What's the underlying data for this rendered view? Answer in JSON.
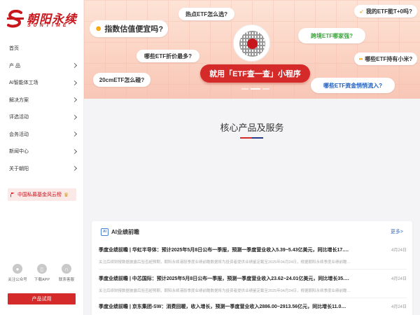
{
  "brand": {
    "cn": "朝阳永续",
    "en": "SUNTIME",
    "color": "#c8161d"
  },
  "nav": [
    {
      "label": "首页",
      "has_arrow": false
    },
    {
      "label": "产 品",
      "has_arrow": true
    },
    {
      "label": "AI智能体工场",
      "has_arrow": true
    },
    {
      "label": "解决方案",
      "has_arrow": true
    },
    {
      "label": "评选活动",
      "has_arrow": true
    },
    {
      "label": "会务活动",
      "has_arrow": true
    },
    {
      "label": "新闻中心",
      "has_arrow": true
    },
    {
      "label": "关于朝阳",
      "has_arrow": true
    }
  ],
  "award": "中国私募基金风云榜",
  "qr_links": [
    {
      "label": "关注公众号",
      "icon": "wechat-icon"
    },
    {
      "label": "下载APP",
      "icon": "phone-icon"
    },
    {
      "label": "联系客服",
      "icon": "headset-icon"
    }
  ],
  "trial_button": "产品试用",
  "banner": {
    "bubbles": {
      "b1": "指数估值便宜吗?",
      "b2": "热点ETF怎么选?",
      "b3": "我的ETF能T+0吗?",
      "b4": "跨境ETF哪家强?",
      "b5": "哪些ETF折价最多?",
      "b6": "哪些ETF持有小米?",
      "b7": "20cmETF怎么碰?",
      "b8": "哪些ETF资金悄悄流入?"
    },
    "promo": "就用「ETF查一查」小程序"
  },
  "section_title": "核心产品及服务",
  "ai_card": {
    "title": "AI业绩前瞻",
    "more": "更多>",
    "items": [
      {
        "title": "季度业绩前瞻 | 华虹半导体：预计2025年5月8日公布一季报，预测一季度营业收入5.39~5.43亿美元，同比增长17.…",
        "date": "4月24日",
        "summary": "关注后续财报数据披露后验否超预期，朝阳永续港股季度业绩前瞻数据将为投资者提供业绩鉴定截至2025年04月24日，根据朝阳永续季度业绩前瞻…"
      },
      {
        "title": "季度业绩前瞻 | 中芯国际：预计2025年5月8日公布一季报，预测一季度营业收入23.62~24.01亿美元，同比增长35.…",
        "date": "4月24日",
        "summary": "关注后续财报数据披露后验否超预期，朝阳永续港股季度业绩前瞻数据将为投资者提供业绩鉴定截至2025年04月24日，根据朝阳永续季度业绩前瞻…"
      },
      {
        "title": "季度业绩前瞻 | 京东集团-SW：消费回暖，收入增长，预测一季度营业收入2886.00~2913.56亿元，同比增长11.0…",
        "date": "4月24日",
        "summary": ""
      }
    ]
  }
}
